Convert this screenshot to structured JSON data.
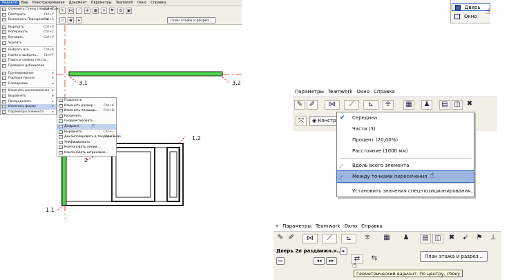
{
  "panel1": {
    "menubar": [
      "Редакти",
      "Вид",
      "Конструирование",
      "Документ",
      "Параметры",
      "Teamwork",
      "Окно",
      "Справка"
    ],
    "edit_menu": [
      {
        "label": "Отменить Стены | Новый этаж",
        "key": "Ctrl+Z"
      },
      {
        "label": "Повторить",
        "key": "Ctrl+Y"
      },
      {
        "label": "Выполнить Повторность",
        "key": "Ctrl+A"
      },
      {
        "sep": true
      },
      {
        "label": "Вырезать",
        "key": "Ctrl+X"
      },
      {
        "label": "Копировать",
        "key": "Ctrl+C"
      },
      {
        "label": "Вставить",
        "key": "Ctrl+V"
      },
      {
        "label": "Удалить",
        "key": ""
      },
      {
        "sep": true
      },
      {
        "label": "Выбрать все",
        "key": "Ctrl+A"
      },
      {
        "label": "Найти и выбрать...",
        "key": "Ctrl+F"
      },
      {
        "label": "Поиск и замена текста...",
        "key": ""
      },
      {
        "label": "Проверка дубликатов",
        "key": ""
      },
      {
        "sep": true
      },
      {
        "label": "Группирование",
        "key": "▸"
      },
      {
        "label": "Порядок показа",
        "key": "▸"
      },
      {
        "label": "Блокировка",
        "key": "▸"
      },
      {
        "sep": true
      },
      {
        "label": "Изменить расположение",
        "key": "▸"
      },
      {
        "label": "Выровнять",
        "key": "▸"
      },
      {
        "label": "Распределить",
        "key": "▸"
      },
      {
        "label": "Изменить форму",
        "key": "▸",
        "on": true
      },
      {
        "label": "Параметры элемента",
        "key": "▸"
      }
    ],
    "reshape_submenu": [
      {
        "label": "Подрезать",
        "key": ""
      },
      {
        "label": "Изменить размер...",
        "key": "Ctrl+K"
      },
      {
        "label": "Изменить площадь...",
        "key": "Ctrl+D"
      },
      {
        "label": "Разделить",
        "key": ""
      },
      {
        "label": "Скорректировать...",
        "key": ""
      },
      {
        "label": "Дефрагм",
        "key": "",
        "on": true
      },
      {
        "label": "Выровнять",
        "key": "Ctrl+="
      },
      {
        "label": "Декомпозировать в текущем виде",
        "key": "Ctrl+T"
      },
      {
        "label": "Унифицировать",
        "key": ""
      },
      {
        "label": "Компоновать линии...",
        "key": ""
      },
      {
        "label": "Компоновать штриховки...",
        "key": ""
      }
    ],
    "toolbar_button": "План этажа и разрез...",
    "point_labels": {
      "p31": "3.1",
      "p32": "3.2",
      "p2": "2",
      "p12": "1.2",
      "p11": "1.1"
    }
  },
  "panel2": {
    "items": [
      {
        "label": "Дверь",
        "on": true
      },
      {
        "label": "Окно",
        "on": false
      }
    ]
  },
  "panel3": {
    "menubar": [
      "Параметры",
      "Teamwork",
      "Окно",
      "Справка"
    ],
    "input_text": "Констру",
    "dropdown": [
      {
        "label": "Середина",
        "check": true
      },
      {
        "label": "Части (3)"
      },
      {
        "label": "Процент (20,00%)"
      },
      {
        "label": "Расстояние (1000 мм)"
      },
      {
        "sep": true
      },
      {
        "label": "Вдоль всего элемента",
        "glyph": "⟋"
      },
      {
        "label": "Между точками пересечения",
        "glyph": "⟋",
        "on": true
      },
      {
        "sep": true
      },
      {
        "label": "Установить значения спец-позиционирования..."
      }
    ]
  },
  "panel4": {
    "menubar": [
      "т",
      "Параметры",
      "Teamwork",
      "Окно",
      "Справка"
    ],
    "object_name": "Дверь 2п раздвижн.н...",
    "plan_button": "План этажа и разрез...",
    "tooltip": "Геометрический вариант: По центру, сбоку"
  },
  "colors": {
    "wall_green": "#4cd64c",
    "marker_red": "#e03020",
    "menu_highlight": "#9db6df"
  }
}
